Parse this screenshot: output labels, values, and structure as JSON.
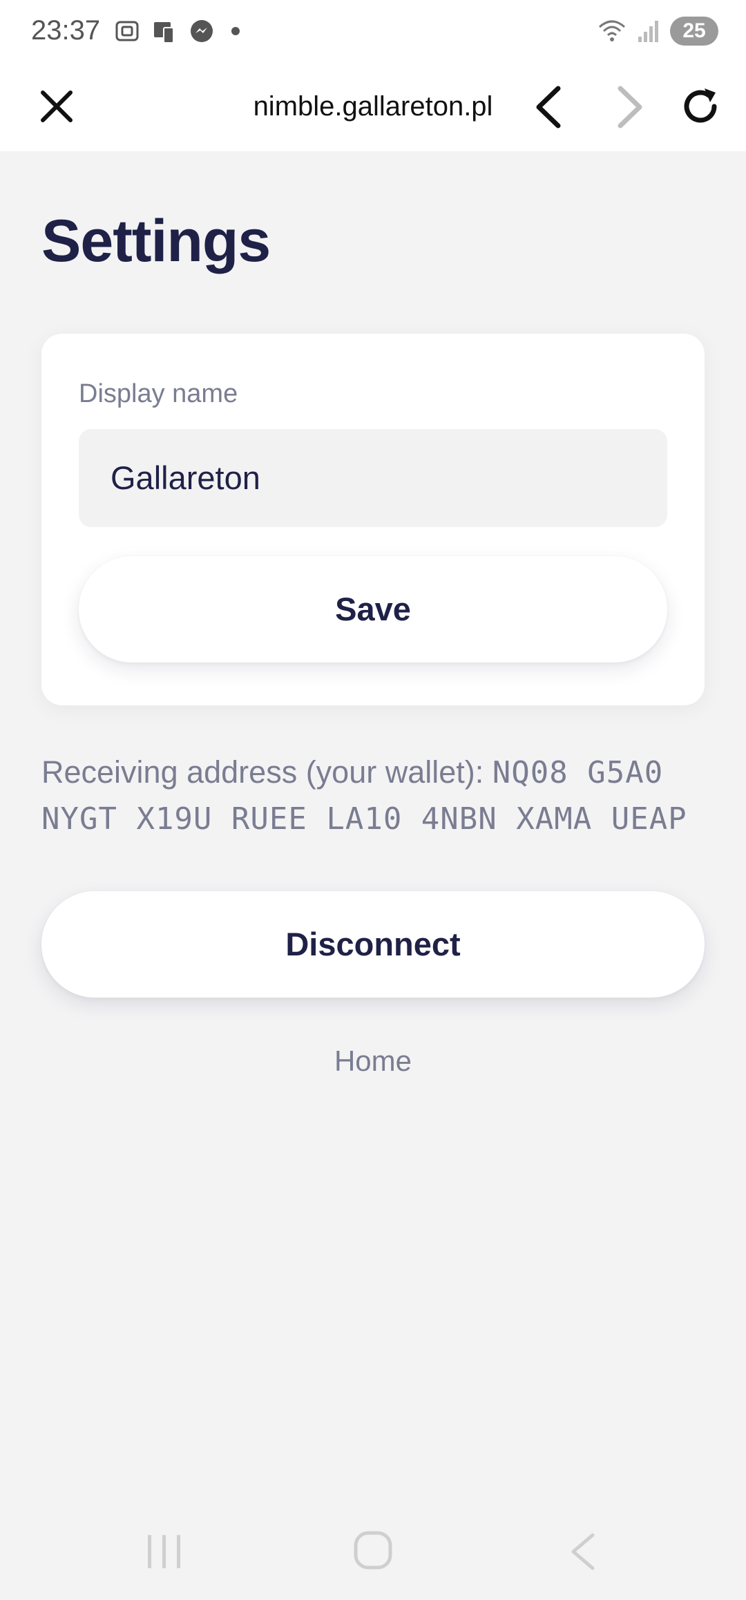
{
  "status_bar": {
    "time": "23:37",
    "battery": "25",
    "icons": [
      "screenshot-icon",
      "phone-clone-icon",
      "messenger-icon",
      "notification-dot-icon",
      "wifi-icon",
      "signal-icon",
      "battery-icon"
    ]
  },
  "browser": {
    "url": "nimble.gallareton.pl",
    "icons": [
      "close-icon",
      "back-arrow-icon",
      "forward-arrow-icon",
      "reload-icon"
    ]
  },
  "page": {
    "title": "Settings",
    "display_name_label": "Display name",
    "display_name_value": "Gallareton",
    "save_label": "Save",
    "address_label": "Receiving address (your wallet): ",
    "address_value": "NQ08 G5A0 NYGT X19U RUEE LA10 4NBN XAMA UEAP",
    "disconnect_label": "Disconnect",
    "home_link": "Home"
  },
  "colors": {
    "background": "#f3f3f4",
    "text_primary": "#1f2147",
    "text_secondary": "#7a7d91",
    "card": "#ffffff"
  },
  "nav_bar": {
    "icons": [
      "recent-apps-icon",
      "home-icon",
      "back-icon"
    ]
  }
}
